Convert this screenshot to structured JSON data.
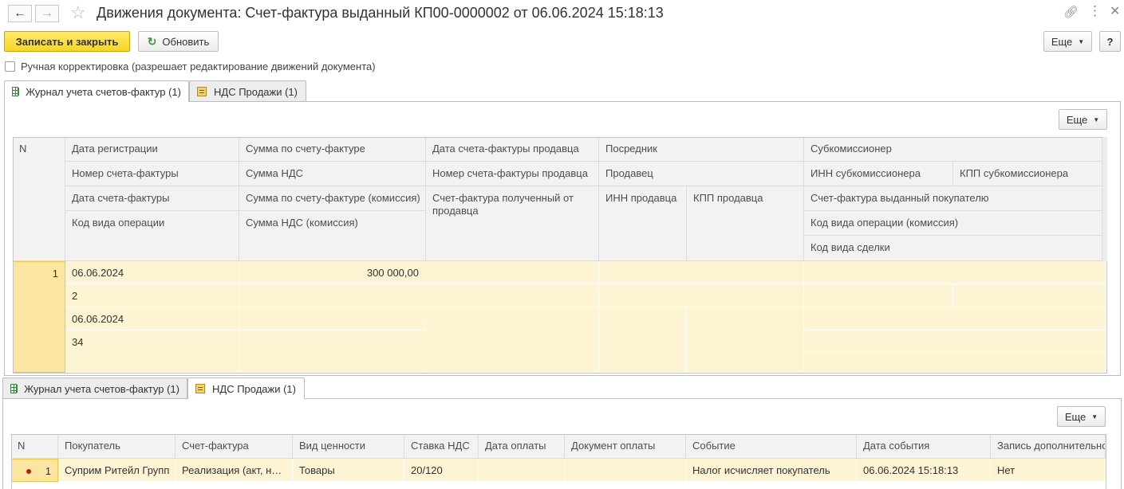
{
  "window": {
    "title": "Движения документа: Счет-фактура выданный КП00-0000002 от 06.06.2024 15:18:13",
    "icons": [
      "arrow-left-icon",
      "arrow-right-icon",
      "star-icon",
      "link-icon",
      "more-vertical-icon",
      "close-icon"
    ]
  },
  "toolbar": {
    "write_close": "Записать и закрыть",
    "refresh": "Обновить",
    "more": "Еще",
    "help": "?"
  },
  "manual_correction": {
    "label": "Ручная корректировка (разрешает редактирование движений документа)",
    "checked": false
  },
  "tabs": [
    {
      "label": "Журнал учета счетов-фактур (1)",
      "icon": "table-icon"
    },
    {
      "label": "НДС Продажи (1)",
      "icon": "register-icon"
    }
  ],
  "journal": {
    "more": "Еще",
    "headers": {
      "n": "N",
      "reg_date": "Дата регистрации",
      "invoice_number": "Номер счета-фактуры",
      "invoice_date": "Дата счета-фактуры",
      "op_code": "Код вида операции",
      "invoice_sum": "Сумма по счету-фактуре",
      "vat_sum": "Сумма НДС",
      "invoice_sum_commission": "Сумма по счету-фактуре (комиссия)",
      "vat_sum_commission": "Сумма НДС (комиссия)",
      "seller_invoice_date": "Дата счета-фактуры продавца",
      "seller_invoice_number": "Номер счета-фактуры продавца",
      "invoice_received": "Счет-фактура полученный от продавца",
      "intermediary": "Посредник",
      "seller": "Продавец",
      "seller_inn": "ИНН продавца",
      "seller_kpp": "КПП продавца",
      "subcommissioner": "Субкомиссионер",
      "subcommissioner_inn": "ИНН субкомиссионера",
      "subcommissioner_kpp": "КПП субкомиссионера",
      "invoice_issued_buyer": "Счет-фактура выданный покупателю",
      "op_code_commission": "Код вида операции (комиссия)",
      "deal_code": "Код вида сделки"
    },
    "row": {
      "n": "1",
      "reg_date": "06.06.2024",
      "invoice_number": "2",
      "invoice_date": "06.06.2024",
      "op_code": "34",
      "invoice_sum": "300 000,00"
    }
  },
  "vat_sales": {
    "more": "Еще",
    "headers": [
      "N",
      "Покупатель",
      "Счет-фактура",
      "Вид ценности",
      "Ставка НДС",
      "Дата оплаты",
      "Документ оплаты",
      "Событие",
      "Дата события",
      "Запись дополнительно"
    ],
    "row": {
      "n": "1",
      "buyer": "Суприм Ритейл Групп",
      "invoice": "Реализация (акт, н…",
      "value_type": "Товары",
      "vat_rate": "20/120",
      "pay_date": "",
      "pay_doc": "",
      "event": "Налог исчисляет покупатель",
      "event_date": "06.06.2024 15:18:13",
      "additional": "Нет"
    }
  }
}
